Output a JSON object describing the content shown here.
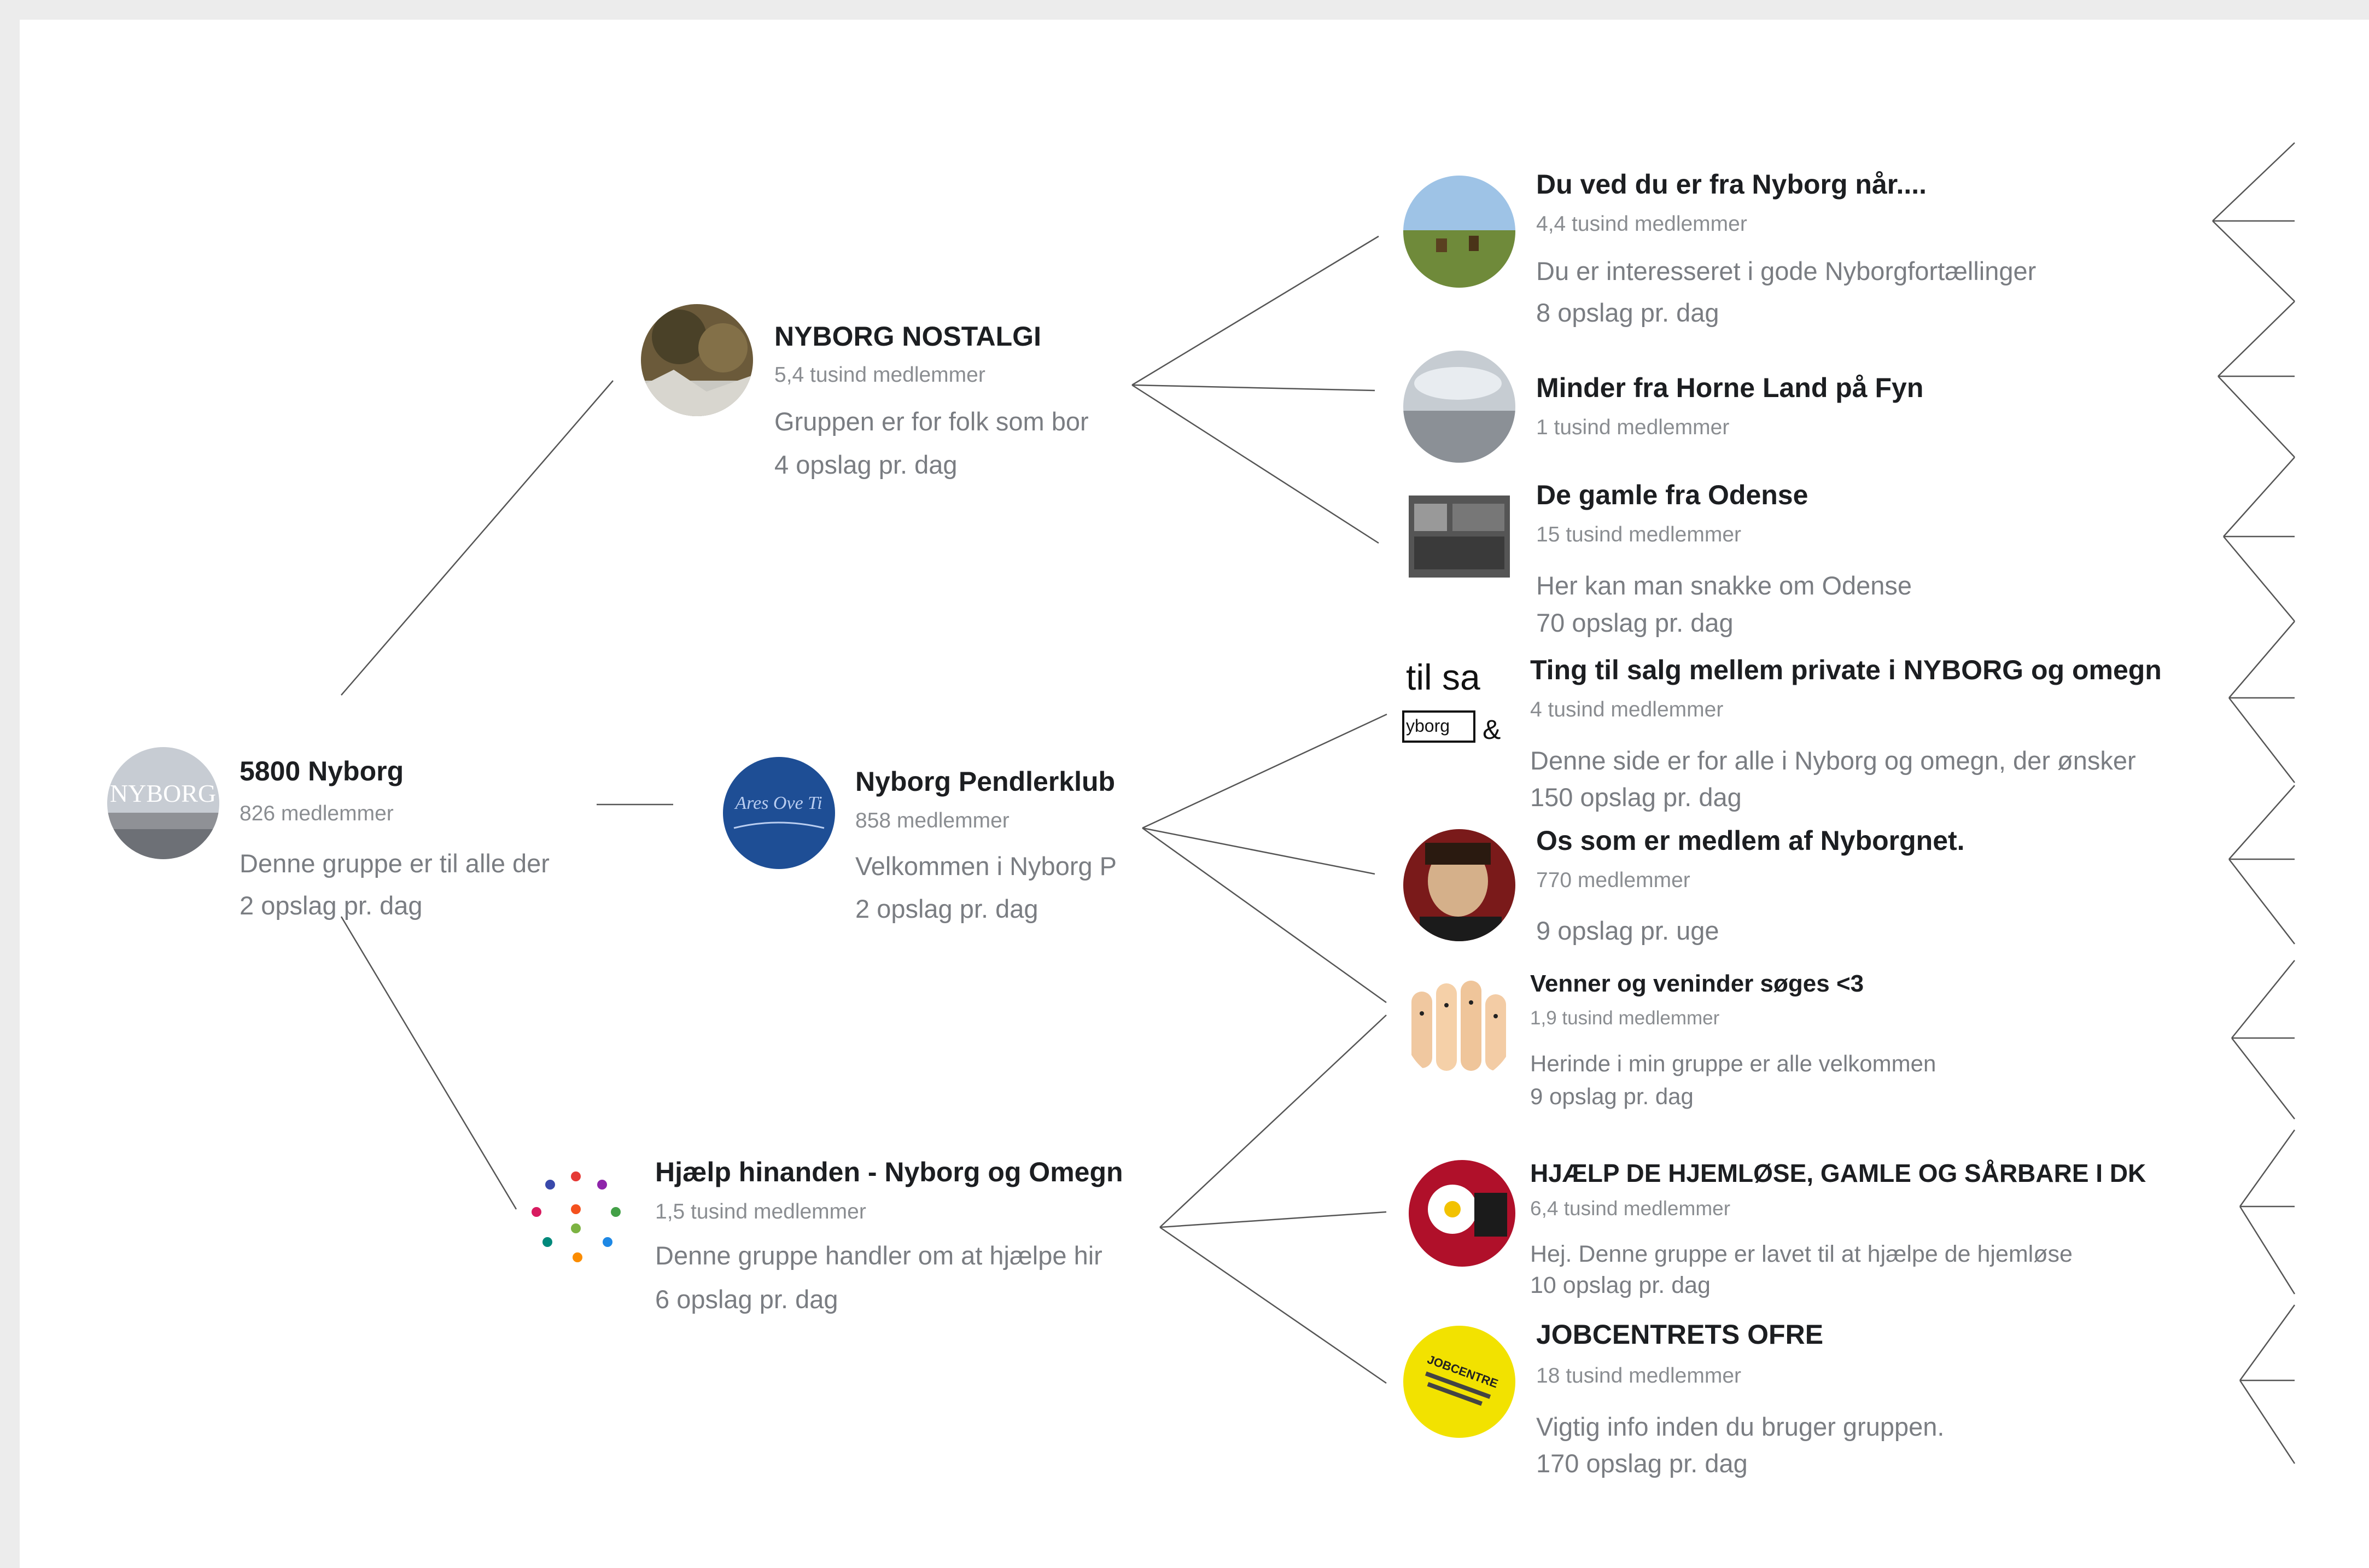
{
  "nodes": {
    "root": {
      "title": "5800 Nyborg",
      "members": "826 medlemmer",
      "description": "Denne gruppe er til alle der",
      "posts": "2 opslag pr. dag",
      "avatar_text": "NYBORG"
    },
    "nostalgi": {
      "title": "NYBORG NOSTALGI",
      "members": "5,4 tusind medlemmer",
      "description": "Gruppen er for folk som bor",
      "posts": "4 opslag pr. dag"
    },
    "pendler": {
      "title": "Nyborg Pendlerklub",
      "members": "858 medlemmer",
      "description": "Velkommen i Nyborg P",
      "posts": "2 opslag pr. dag",
      "avatar_text": "Ares   Ove Ti"
    },
    "hjaelp": {
      "title": "Hjælp hinanden - Nyborg og Omegn",
      "members": "1,5 tusind medlemmer",
      "description": "Denne gruppe handler om at hjælpe hir",
      "posts": "6 opslag pr. dag"
    },
    "duved": {
      "title": "Du ved du er fra Nyborg når....",
      "members": "4,4 tusind medlemmer",
      "description": "Du er interesseret i gode Nyborgfortællinger",
      "posts": "8 opslag pr. dag"
    },
    "minder": {
      "title": "Minder fra Horne Land på Fyn",
      "members": "1 tusind medlemmer"
    },
    "gamle": {
      "title": "De gamle fra Odense",
      "members": "15 tusind medlemmer",
      "description": "Her kan man snakke om Odense",
      "posts": "70 opslag pr. dag"
    },
    "ting": {
      "title": "Ting til salg mellem private i NYBORG og omegn",
      "members": "4 tusind medlemmer",
      "description": "Denne side er for alle i Nyborg og omegn, der ønsker",
      "posts": "150 opslag pr. dag",
      "avatar_text_1": "til sa",
      "avatar_text_2": "yborg"
    },
    "os": {
      "title": "Os som er medlem af Nyborgnet.",
      "members": "770 medlemmer",
      "posts": "9 opslag pr. uge"
    },
    "venner": {
      "title": "Venner og veninder søges <3",
      "members": "1,9 tusind medlemmer",
      "description": "Herinde i min gruppe er alle velkommen",
      "posts": "9 opslag pr. dag"
    },
    "hjemlose": {
      "title": "HJÆLP DE HJEMLØSE, GAMLE OG SÅRBARE I DK",
      "members": "6,4 tusind medlemmer",
      "description": "Hej. Denne gruppe er lavet til at hjælpe de hjemløse",
      "posts": "10 opslag pr. dag"
    },
    "jobcentret": {
      "title": "JOBCENTRETS OFRE",
      "members": "18 tusind medlemmer",
      "description": "Vigtig info inden du bruger gruppen.",
      "posts": "170 opslag pr. dag",
      "avatar_text": "JOBCENTRE"
    }
  },
  "colors": {
    "background": "#ececec",
    "card": "#ffffff",
    "title": "#1c1e21",
    "meta": "#8a8d91",
    "line": "#555555",
    "jobcentret_yellow": "#f2e200",
    "pendler_blue": "#1e4e95"
  }
}
